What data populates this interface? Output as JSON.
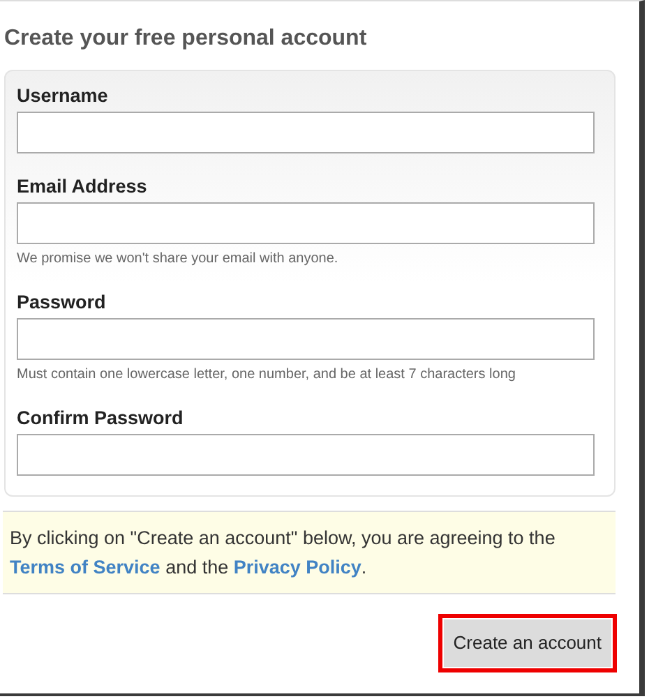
{
  "heading": "Create your free personal account",
  "fields": [
    {
      "label": "Username"
    },
    {
      "label": "Email Address",
      "hint": "We promise we won't share your email with anyone."
    },
    {
      "label": "Password",
      "hint": "Must contain one lowercase letter, one number, and be at least 7 characters long"
    },
    {
      "label": "Confirm Password"
    }
  ],
  "agreement": {
    "text_before": "By clicking on \"Create an account\" below, you are agreeing to the ",
    "terms_link": "Terms of Service",
    "text_middle": " and the ",
    "privacy_link": "Privacy Policy",
    "text_after": "."
  },
  "submit_button": {
    "label": "Create an account",
    "highlighted": true
  }
}
